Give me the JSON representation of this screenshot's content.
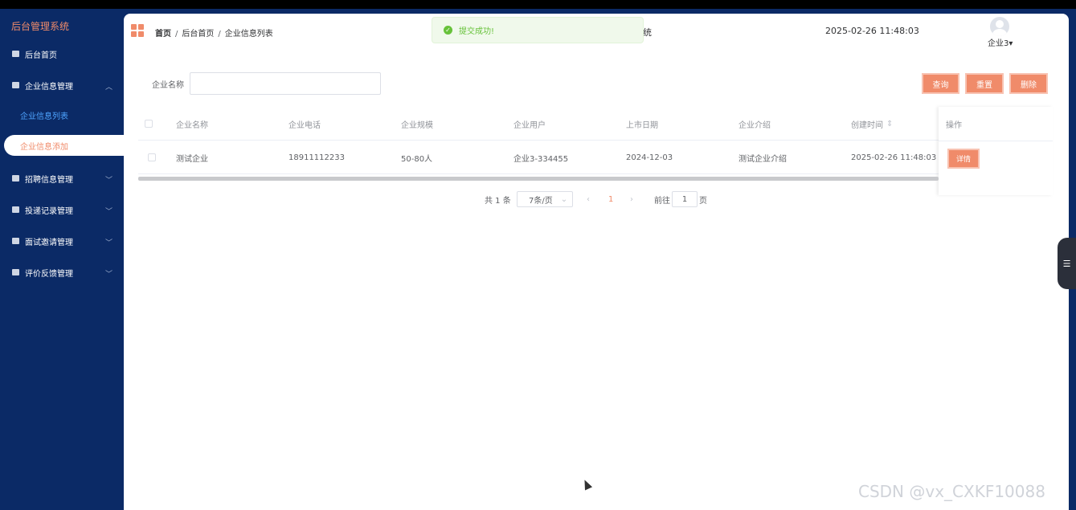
{
  "sidebar": {
    "brand": "后台管理系统",
    "home": "后台首页",
    "groups": [
      {
        "label": "企业信息管理",
        "children": [
          "企业信息列表",
          "企业信息添加"
        ]
      },
      {
        "label": "招聘信息管理"
      },
      {
        "label": "投递记录管理"
      },
      {
        "label": "面试邀请管理"
      },
      {
        "label": "评价反馈管理"
      }
    ]
  },
  "header": {
    "breadcrumb": [
      "首页",
      "后台首页",
      "企业信息列表"
    ],
    "title_fragment": "统",
    "datetime": "2025-02-26 11:48:03",
    "user": "企业3"
  },
  "toast": {
    "message": "提交成功!"
  },
  "search": {
    "label": "企业名称",
    "value": "",
    "buttons": {
      "query": "查询",
      "reset": "重置",
      "delete": "删除"
    }
  },
  "table": {
    "columns": [
      "企业名称",
      "企业电话",
      "企业规模",
      "企业用户",
      "上市日期",
      "企业介绍",
      "创建时间",
      "操作"
    ],
    "rows": [
      [
        "测试企业",
        "18911112233",
        "50-80人",
        "企业3-334455",
        "2024-12-03",
        "测试企业介绍",
        "2025-02-26 11:48:03",
        "详情"
      ]
    ]
  },
  "pagination": {
    "total": "共 1 条",
    "page_size": "7条/页",
    "current": "1",
    "goto_label": "前往",
    "goto_value": "1",
    "page_unit": "页"
  },
  "watermark": "CSDN @vx_CXKF10088",
  "colors": {
    "sidebar": "#0b2a66",
    "accent": "#f08b6a",
    "success": "#67c23a"
  }
}
